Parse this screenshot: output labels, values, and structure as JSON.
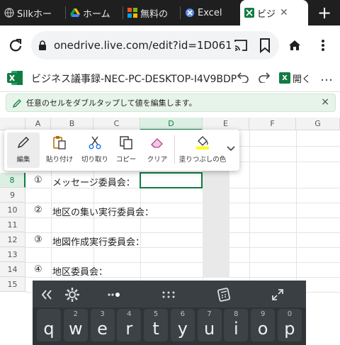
{
  "browser": {
    "tabs": [
      {
        "label": "Silkホー",
        "icon": "silk-favicon",
        "active": false
      },
      {
        "label": "ホーム",
        "icon": "google-drive-favicon",
        "active": false
      },
      {
        "label": "無料の",
        "icon": "windows-favicon",
        "active": false
      },
      {
        "label": "Excel",
        "icon": "excel-favicon",
        "active": false
      },
      {
        "label": "ビジ",
        "icon": "excel-favicon",
        "active": true
      }
    ],
    "new_tab_label": "+",
    "url": "onedrive.live.com/edit?id=1D061"
  },
  "excel": {
    "title": "ビジネス議事録-NEC-PC-DESKTOP-I4V9BDP",
    "open_label": "開く",
    "more_label": "…",
    "banner_text": "任意のセルをダブルタップして値を編集します。",
    "banner_close": "×"
  },
  "grid": {
    "columns": [
      "A",
      "B",
      "C",
      "D",
      "E",
      "F",
      "G"
    ],
    "selected_column": "D",
    "rows": [
      "8",
      "9",
      "10",
      "11",
      "12",
      "13",
      "14",
      "15"
    ],
    "selected_row": "8",
    "cells": [
      {
        "row": "8",
        "num": "①",
        "text": "メッセージ委員会："
      },
      {
        "row": "10",
        "num": "②",
        "text": "地区の集い実行委員会："
      },
      {
        "row": "12",
        "num": "③",
        "text": "地図作成実行委員会："
      },
      {
        "row": "14",
        "num": "④",
        "text": "地区委員会："
      }
    ]
  },
  "context_toolbar": {
    "items": [
      {
        "label": "編集",
        "icon": "pencil-icon"
      },
      {
        "label": "貼り付け",
        "icon": "paste-icon"
      },
      {
        "label": "切り取り",
        "icon": "scissors-icon"
      },
      {
        "label": "コピー",
        "icon": "copy-icon"
      },
      {
        "label": "クリア",
        "icon": "eraser-icon"
      },
      {
        "label": "塗りつぶしの色",
        "icon": "fill-color-icon"
      }
    ],
    "fill_color": "#ffff00"
  },
  "keyboard": {
    "keys": [
      "q",
      "w",
      "e",
      "r",
      "t",
      "y",
      "u",
      "i",
      "o",
      "p"
    ],
    "hints": [
      "",
      "2",
      "3",
      "4",
      "5",
      "6",
      "7",
      "8",
      "9",
      "0"
    ]
  },
  "colors": {
    "excel_green": "#107c41",
    "banner_bg": "#e6f4ea",
    "tab_strip": "#1f1f1f",
    "keyboard_bg": "#2f3438"
  }
}
